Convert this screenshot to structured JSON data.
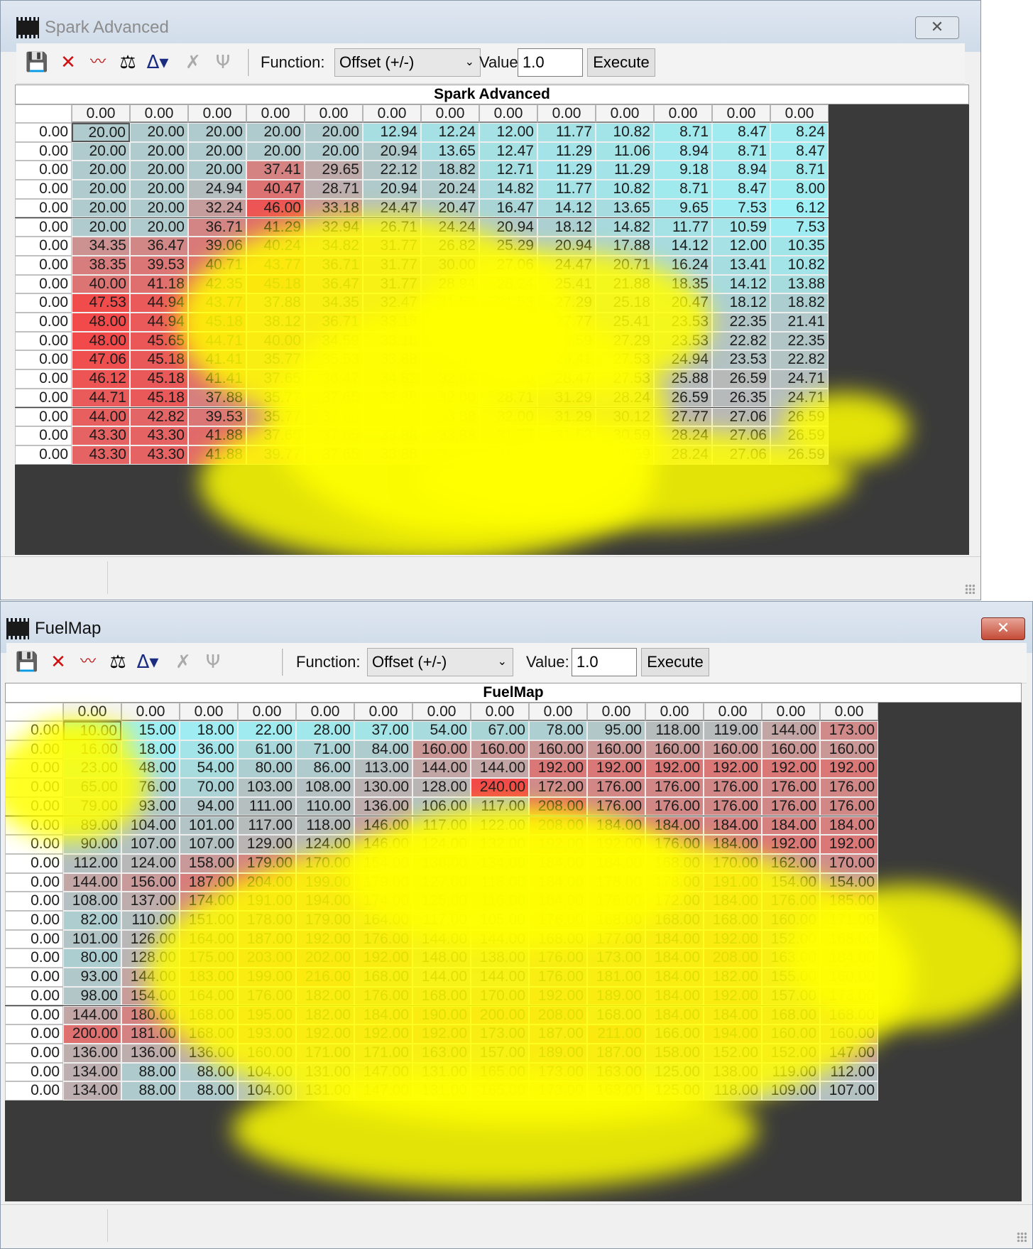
{
  "windows": [
    {
      "title": "Spark Advanced",
      "close_label": "✕",
      "toolbar": {
        "function_label": "Function:",
        "function_value": "Offset (+/-)",
        "value_label": "Value:",
        "value": "1.0",
        "execute_label": "Execute",
        "icons": [
          "save-icon",
          "delete-icon",
          "graph-icon",
          "balance-scale-icon",
          "marker-icon",
          "interpolate-x-icon",
          "interpolate-y-icon"
        ]
      },
      "grid": {
        "title": "Spark Advanced",
        "col_headers": [
          "0.00",
          "0.00",
          "0.00",
          "0.00",
          "0.00",
          "0.00",
          "0.00",
          "0.00",
          "0.00",
          "0.00",
          "0.00",
          "0.00",
          "0.00"
        ],
        "row_headers": [
          "0.00",
          "0.00",
          "0.00",
          "0.00",
          "0.00",
          "0.00",
          "0.00",
          "0.00",
          "0.00",
          "0.00",
          "0.00",
          "0.00",
          "0.00",
          "0.00",
          "0.00",
          "0.00",
          "0.00",
          "0.00"
        ],
        "rows": [
          [
            "20.00",
            "20.00",
            "20.00",
            "20.00",
            "20.00",
            "12.94",
            "12.24",
            "12.00",
            "11.77",
            "10.82",
            "8.71",
            "8.47",
            "8.24"
          ],
          [
            "20.00",
            "20.00",
            "20.00",
            "20.00",
            "20.00",
            "20.94",
            "13.65",
            "12.47",
            "11.29",
            "11.06",
            "8.94",
            "8.71",
            "8.47"
          ],
          [
            "20.00",
            "20.00",
            "20.00",
            "37.41",
            "29.65",
            "22.12",
            "18.82",
            "12.71",
            "11.29",
            "11.29",
            "9.18",
            "8.94",
            "8.71"
          ],
          [
            "20.00",
            "20.00",
            "24.94",
            "40.47",
            "28.71",
            "20.94",
            "20.24",
            "14.82",
            "11.77",
            "10.82",
            "8.71",
            "8.47",
            "8.00"
          ],
          [
            "20.00",
            "20.00",
            "32.24",
            "46.00",
            "33.18",
            "24.47",
            "20.47",
            "16.47",
            "14.12",
            "13.65",
            "9.65",
            "7.53",
            "6.12"
          ],
          [
            "20.00",
            "20.00",
            "36.71",
            "41.29",
            "32.94",
            "26.71",
            "24.24",
            "20.94",
            "18.12",
            "14.82",
            "11.77",
            "10.59",
            "7.53"
          ],
          [
            "34.35",
            "36.47",
            "39.06",
            "40.24",
            "34.82",
            "31.77",
            "26.82",
            "25.29",
            "20.94",
            "17.88",
            "14.12",
            "12.00",
            "10.35"
          ],
          [
            "38.35",
            "39.53",
            "40.71",
            "43.77",
            "36.71",
            "31.77",
            "30.00",
            "27.06",
            "24.47",
            "20.71",
            "16.24",
            "13.41",
            "10.82"
          ],
          [
            "40.00",
            "41.18",
            "42.35",
            "45.18",
            "36.47",
            "31.77",
            "28.94",
            "28.24",
            "25.41",
            "21.88",
            "18.35",
            "14.12",
            "13.88"
          ],
          [
            "47.53",
            "44.94",
            "43.77",
            "37.88",
            "34.35",
            "32.47",
            "31.53",
            "31.53",
            "27.29",
            "25.18",
            "20.47",
            "18.12",
            "18.82"
          ],
          [
            "48.00",
            "44.94",
            "45.18",
            "38.12",
            "36.71",
            "33.18",
            "31.06",
            "31.06",
            "27.77",
            "25.41",
            "23.53",
            "22.35",
            "21.41"
          ],
          [
            "48.00",
            "45.65",
            "44.71",
            "40.00",
            "34.59",
            "33.18",
            "31.06",
            "29.18",
            "30.59",
            "27.29",
            "23.53",
            "22.82",
            "22.35"
          ],
          [
            "47.06",
            "45.18",
            "41.41",
            "35.77",
            "35.53",
            "33.88",
            "32.47",
            "31.29",
            "29.41",
            "27.53",
            "24.94",
            "23.53",
            "22.82"
          ],
          [
            "46.12",
            "45.18",
            "41.41",
            "37.65",
            "36.47",
            "34.82",
            "32.94",
            "31.29",
            "28.47",
            "27.53",
            "25.88",
            "26.59",
            "24.71"
          ],
          [
            "44.71",
            "45.18",
            "37.88",
            "35.77",
            "37.65",
            "33.88",
            "32.00",
            "28.71",
            "31.29",
            "28.24",
            "26.59",
            "26.35",
            "24.71"
          ],
          [
            "44.00",
            "42.82",
            "39.53",
            "35.77",
            "37.65",
            "33.88",
            "33.88",
            "32.00",
            "31.29",
            "30.12",
            "27.77",
            "27.06",
            "26.59"
          ],
          [
            "43.30",
            "43.30",
            "41.88",
            "37.65",
            "37.65",
            "33.88",
            "33.88",
            "31.77",
            "31.53",
            "30.59",
            "28.24",
            "27.06",
            "26.59"
          ],
          [
            "43.30",
            "43.30",
            "41.88",
            "39.77",
            "37.65",
            "33.88",
            "33.88",
            "31.77",
            "31.53",
            "30.59",
            "28.24",
            "27.06",
            "26.59"
          ]
        ]
      }
    },
    {
      "title": "FuelMap",
      "close_label": "✕",
      "toolbar": {
        "function_label": "Function:",
        "function_value": "Offset (+/-)",
        "value_label": "Value:",
        "value": "1.0",
        "execute_label": "Execute",
        "icons": [
          "save-icon",
          "delete-icon",
          "graph-icon",
          "balance-scale-icon",
          "marker-icon",
          "interpolate-x-icon",
          "interpolate-y-icon"
        ]
      },
      "grid": {
        "title": "FuelMap",
        "col_headers": [
          "0.00",
          "0.00",
          "0.00",
          "0.00",
          "0.00",
          "0.00",
          "0.00",
          "0.00",
          "0.00",
          "0.00",
          "0.00",
          "0.00",
          "0.00",
          "0.00"
        ],
        "row_headers": [
          "0.00",
          "0.00",
          "0.00",
          "0.00",
          "0.00",
          "0.00",
          "0.00",
          "0.00",
          "0.00",
          "0.00",
          "0.00",
          "0.00",
          "0.00",
          "0.00",
          "0.00",
          "0.00",
          "0.00",
          "0.00",
          "0.00",
          "0.00"
        ],
        "rows": [
          [
            "10.00",
            "15.00",
            "18.00",
            "22.00",
            "28.00",
            "37.00",
            "54.00",
            "67.00",
            "78.00",
            "95.00",
            "118.00",
            "119.00",
            "144.00",
            "173.00"
          ],
          [
            "16.00",
            "18.00",
            "36.00",
            "61.00",
            "71.00",
            "84.00",
            "160.00",
            "160.00",
            "160.00",
            "160.00",
            "160.00",
            "160.00",
            "160.00",
            "160.00"
          ],
          [
            "23.00",
            "48.00",
            "54.00",
            "80.00",
            "86.00",
            "113.00",
            "144.00",
            "144.00",
            "192.00",
            "192.00",
            "192.00",
            "192.00",
            "192.00",
            "192.00"
          ],
          [
            "65.00",
            "76.00",
            "70.00",
            "103.00",
            "108.00",
            "130.00",
            "128.00",
            "240.00",
            "172.00",
            "176.00",
            "176.00",
            "176.00",
            "176.00",
            "176.00"
          ],
          [
            "79.00",
            "93.00",
            "94.00",
            "111.00",
            "110.00",
            "136.00",
            "106.00",
            "117.00",
            "208.00",
            "176.00",
            "176.00",
            "176.00",
            "176.00",
            "176.00"
          ],
          [
            "89.00",
            "104.00",
            "101.00",
            "117.00",
            "118.00",
            "146.00",
            "117.00",
            "122.00",
            "208.00",
            "184.00",
            "184.00",
            "184.00",
            "184.00",
            "184.00"
          ],
          [
            "90.00",
            "107.00",
            "107.00",
            "129.00",
            "124.00",
            "146.00",
            "124.00",
            "132.00",
            "192.00",
            "192.00",
            "176.00",
            "184.00",
            "192.00",
            "192.00"
          ],
          [
            "112.00",
            "124.00",
            "158.00",
            "179.00",
            "170.00",
            "154.00",
            "138.00",
            "134.00",
            "184.00",
            "184.00",
            "168.00",
            "170.00",
            "162.00",
            "170.00"
          ],
          [
            "144.00",
            "156.00",
            "187.00",
            "204.00",
            "199.00",
            "179.00",
            "127.00",
            "118.00",
            "184.00",
            "178.00",
            "178.00",
            "191.00",
            "154.00",
            "154.00"
          ],
          [
            "108.00",
            "137.00",
            "174.00",
            "191.00",
            "194.00",
            "174.00",
            "125.00",
            "116.00",
            "184.00",
            "176.00",
            "172.00",
            "184.00",
            "176.00",
            "185.00"
          ],
          [
            "82.00",
            "110.00",
            "151.00",
            "178.00",
            "179.00",
            "164.00",
            "117.00",
            "105.00",
            "176.00",
            "168.00",
            "168.00",
            "168.00",
            "160.00",
            "171.00"
          ],
          [
            "101.00",
            "126.00",
            "164.00",
            "187.00",
            "192.00",
            "176.00",
            "144.00",
            "144.00",
            "168.00",
            "177.00",
            "184.00",
            "192.00",
            "152.00",
            "168.00"
          ],
          [
            "80.00",
            "128.00",
            "175.00",
            "203.00",
            "202.00",
            "192.00",
            "148.00",
            "138.00",
            "176.00",
            "173.00",
            "184.00",
            "208.00",
            "163.00",
            "184.00"
          ],
          [
            "93.00",
            "144.00",
            "183.00",
            "199.00",
            "216.00",
            "168.00",
            "144.00",
            "144.00",
            "176.00",
            "181.00",
            "184.00",
            "182.00",
            "155.00",
            "160.00"
          ],
          [
            "98.00",
            "154.00",
            "164.00",
            "176.00",
            "182.00",
            "176.00",
            "168.00",
            "170.00",
            "192.00",
            "189.00",
            "184.00",
            "192.00",
            "157.00",
            "173.00"
          ],
          [
            "144.00",
            "180.00",
            "168.00",
            "195.00",
            "182.00",
            "184.00",
            "190.00",
            "200.00",
            "208.00",
            "168.00",
            "184.00",
            "184.00",
            "168.00",
            "168.00"
          ],
          [
            "200.00",
            "181.00",
            "168.00",
            "193.00",
            "192.00",
            "192.00",
            "192.00",
            "173.00",
            "187.00",
            "211.00",
            "166.00",
            "194.00",
            "160.00",
            "160.00"
          ],
          [
            "136.00",
            "136.00",
            "136.00",
            "160.00",
            "171.00",
            "171.00",
            "163.00",
            "157.00",
            "189.00",
            "187.00",
            "158.00",
            "152.00",
            "152.00",
            "147.00"
          ],
          [
            "134.00",
            "88.00",
            "88.00",
            "104.00",
            "131.00",
            "147.00",
            "131.00",
            "165.00",
            "173.00",
            "163.00",
            "125.00",
            "138.00",
            "119.00",
            "112.00"
          ],
          [
            "134.00",
            "88.00",
            "88.00",
            "104.00",
            "131.00",
            "147.00",
            "131.00",
            "165.00",
            "173.00",
            "163.00",
            "125.00",
            "118.00",
            "109.00",
            "107.00"
          ]
        ]
      }
    }
  ],
  "colors": {
    "low": "#9df1f6",
    "mid": "#b8b8b8",
    "high": "#f24a4a",
    "highlight": "#ffff00"
  }
}
